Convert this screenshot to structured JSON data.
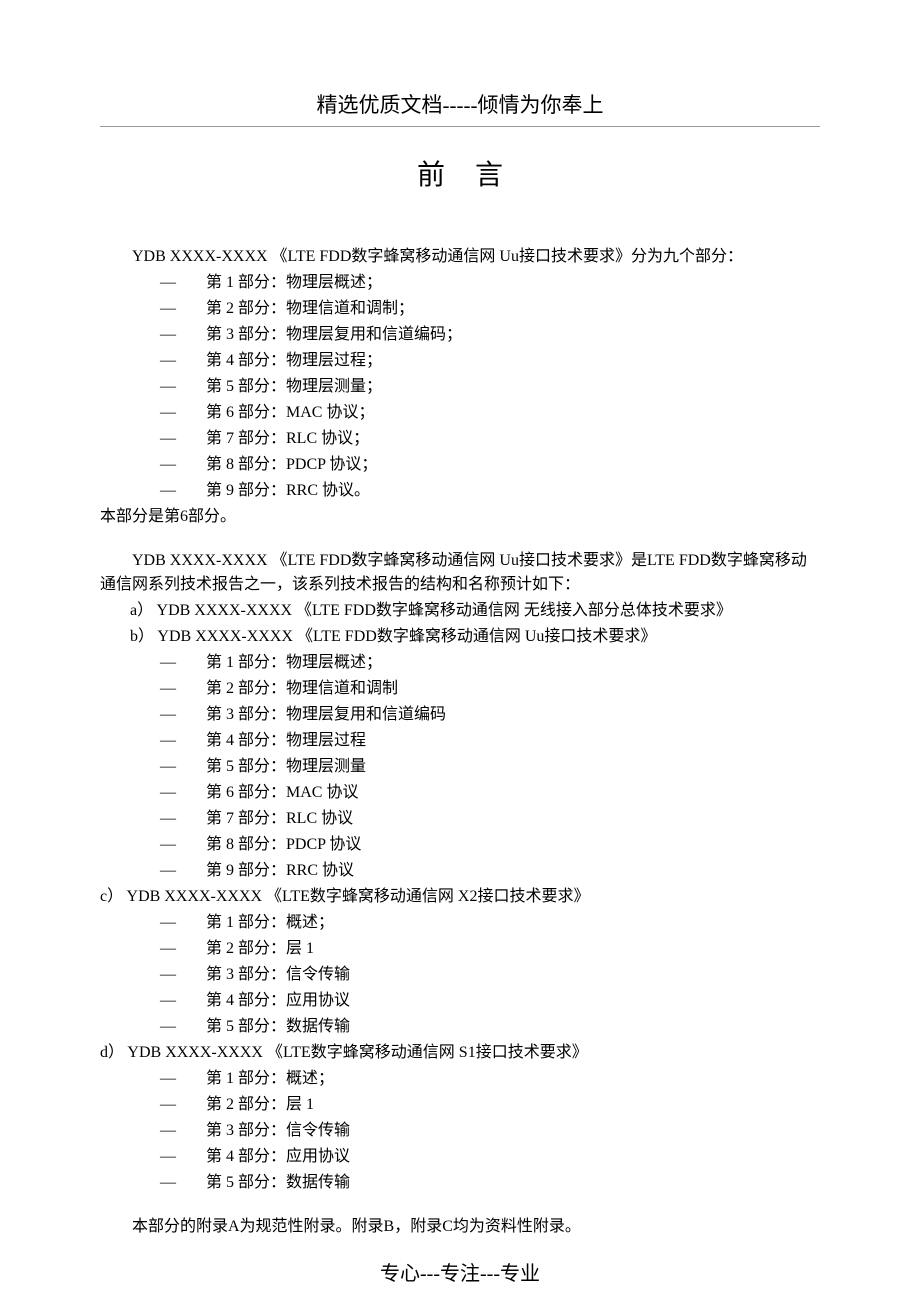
{
  "header": "精选优质文档-----倾情为你奉上",
  "title": "前言",
  "intro": "YDB XXXX-XXXX 《LTE FDD数字蜂窝移动通信网 Uu接口技术要求》分为九个部分：",
  "parts1": [
    "第 1 部分：物理层概述；",
    "第 2 部分：物理信道和调制；",
    "第 3 部分：物理层复用和信道编码；",
    "第 4 部分：物理层过程；",
    "第 5 部分：物理层测量；",
    "第 6 部分：MAC 协议；",
    "第 7 部分：RLC 协议；",
    "第 8 部分：PDCP 协议；",
    "第 9 部分：RRC 协议。"
  ],
  "thispart": "本部分是第6部分。",
  "series_intro": "YDB XXXX-XXXX 《LTE FDD数字蜂窝移动通信网 Uu接口技术要求》是LTE FDD数字蜂窝移动通信网系列技术报告之一，该系列技术报告的结构和名称预计如下：",
  "group_a_label": "a）  YDB XXXX-XXXX 《LTE FDD数字蜂窝移动通信网 无线接入部分总体技术要求》",
  "group_b_label": "b）  YDB XXXX-XXXX 《LTE FDD数字蜂窝移动通信网 Uu接口技术要求》",
  "group_b_items": [
    "第 1 部分：物理层概述；",
    "第 2 部分：物理信道和调制",
    "第 3 部分：物理层复用和信道编码",
    "第 4 部分：物理层过程",
    "第 5 部分：物理层测量",
    "第 6 部分：MAC 协议",
    "第 7 部分：RLC 协议",
    "第 8 部分：PDCP 协议",
    "第 9 部分：RRC 协议"
  ],
  "group_c_label": "c）  YDB XXXX-XXXX 《LTE数字蜂窝移动通信网 X2接口技术要求》",
  "group_c_items": [
    "第 1 部分：概述；",
    "第 2 部分：层 1",
    "第 3 部分：信令传输",
    "第 4 部分：应用协议",
    "第 5 部分：数据传输"
  ],
  "group_d_label": "d）  YDB XXXX-XXXX 《LTE数字蜂窝移动通信网 S1接口技术要求》",
  "group_d_items": [
    "第 1 部分：概述；",
    "第 2 部分：层 1",
    "第 3 部分：信令传输",
    "第 4 部分：应用协议",
    "第 5 部分：数据传输"
  ],
  "appendix": "本部分的附录A为规范性附录。附录B，附录C均为资料性附录。",
  "footer": "专心---专注---专业",
  "dash": "—"
}
